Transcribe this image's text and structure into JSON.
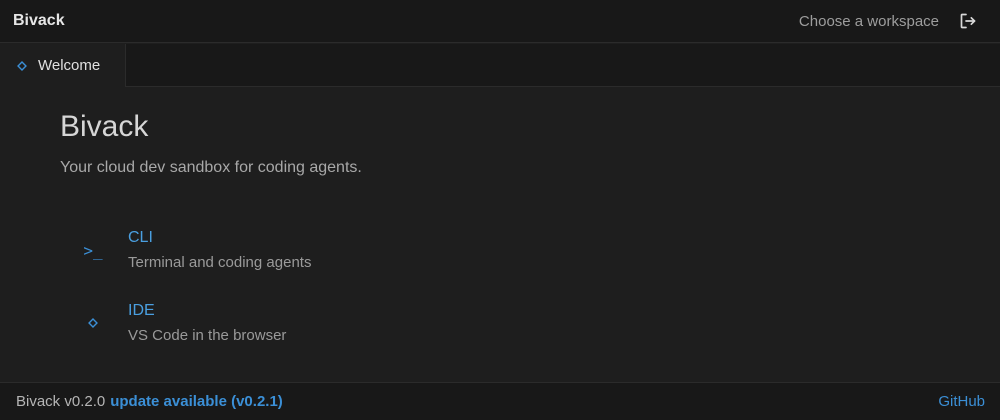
{
  "titlebar": {
    "app_name": "Bivack",
    "workspace_label": "Choose a workspace",
    "logout_icon": "sign-out-icon"
  },
  "tabs": [
    {
      "label": "Welcome",
      "icon": "diamond-icon",
      "active": true
    }
  ],
  "main": {
    "title": "Bivack",
    "subtitle": "Your cloud dev sandbox for coding agents.",
    "launchers": [
      {
        "title": "CLI",
        "description": "Terminal and coding agents",
        "icon": "terminal-prompt-icon",
        "glyph": ">_"
      },
      {
        "title": "IDE",
        "description": "VS Code in the browser",
        "icon": "diamond-icon"
      }
    ]
  },
  "statusbar": {
    "version": "Bivack v0.2.0",
    "update": "update available (v0.2.1)",
    "github": "GitHub"
  },
  "colors": {
    "background": "#1e1e1e",
    "chrome": "#181818",
    "accent": "#3b8fd6",
    "text": "#cccccc",
    "muted": "#9a9a9a"
  }
}
